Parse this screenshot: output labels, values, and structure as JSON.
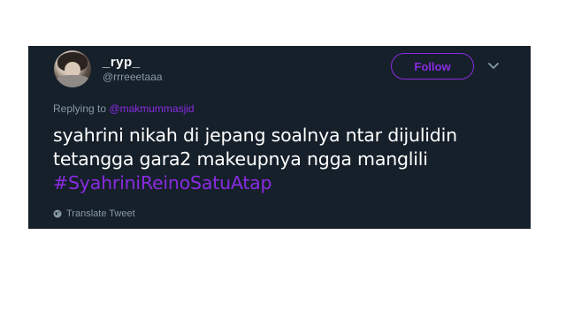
{
  "user": {
    "display_name": "_ryp_",
    "handle": "@rrreeetaaa"
  },
  "follow_button": {
    "label": "Follow"
  },
  "reply": {
    "prefix": "Replying to",
    "mention": "@makmummasjid"
  },
  "tweet": {
    "line1": "syahrini nikah di jepang soalnya ntar dijulidin",
    "line2": "tetangga gara2 makeupnya ngga manglili",
    "hashtag": "#SyahriniReinoSatuAtap"
  },
  "translate": {
    "label": "Translate Tweet"
  },
  "icons": {
    "avatar": "user-avatar",
    "menu": "chevron-down-icon",
    "translate": "globe-icon"
  },
  "colors": {
    "background": "#15202b",
    "accent": "#8a2be2",
    "secondary_text": "#8899a6",
    "primary_text": "#ffffff"
  }
}
